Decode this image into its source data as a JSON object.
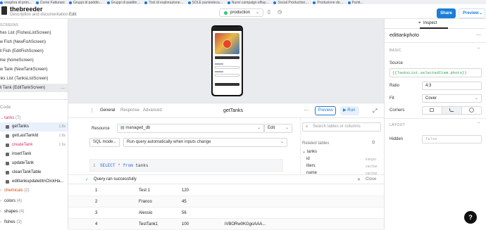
{
  "bookmarks": [
    "onophra di prim...",
    "Come Fatturare",
    "Gruppi di paddin…",
    "Gruppi di paddin…",
    "Tool di esplorazione…",
    "SOLE paninoteca…",
    "Nuovi campaign eBay…",
    "Social Production…",
    "Produzione de…",
    "Partit…"
  ],
  "app": {
    "name": "thebreeder",
    "description": "Description and documentation",
    "edit_label": "Edit"
  },
  "env": {
    "label": "production",
    "status_color": "#2ecc71"
  },
  "toolbar": {
    "share_label": "Share",
    "preview_label": "Preview"
  },
  "screens": {
    "header": "SCREENS",
    "items": [
      "Fishes List (FishesListScreen)",
      "New Fish (NewFishScreen)",
      "Edit Fish (EditFishScreen)",
      "Home (homeScreen)",
      "New Tank (NewTankScreen)",
      "Tanks List (TanksListScreen)",
      "Edit Tank (EditTankScreen)"
    ],
    "selected_index": 6,
    "more": "…"
  },
  "code_tree": {
    "header": "Code",
    "tanks": {
      "label": "tanks",
      "count": "(7)"
    },
    "queries": [
      {
        "label": "getTanks",
        "time": "1.8s",
        "selected": true
      },
      {
        "label": "getLastTankId",
        "time": "1.8s"
      },
      {
        "label": "createTank",
        "time": "1.6s",
        "color": "#d6336c"
      },
      {
        "label": "insertTank",
        "time": ""
      },
      {
        "label": "updateTank",
        "time": ""
      },
      {
        "label": "cleanTankTable",
        "time": ""
      },
      {
        "label": "edittankupdatebtnClickHa...",
        "time": ""
      }
    ],
    "other": [
      {
        "label": "chemicals",
        "count": "(2)",
        "color": "#d9480f"
      },
      {
        "label": "colors",
        "count": "(4)"
      },
      {
        "label": "shapes",
        "count": "(4)"
      },
      {
        "label": "fishes",
        "count": "(3)"
      }
    ]
  },
  "query": {
    "tabs": [
      "General",
      "Response",
      "Advanced"
    ],
    "active_tab": "General",
    "title": "getTanks",
    "preview_label": "Preview",
    "run_label": "Run",
    "resource_label": "Resource",
    "resource_value": "managed_db",
    "resource_mode": "Edit",
    "sql_mode": "SQL mode",
    "run_mode": "Run query automatically when inputs change",
    "code": {
      "line": "1",
      "select": "SELECT",
      "star": "*",
      "from": "from",
      "table": "tanks"
    },
    "schema": {
      "search_placeholder": "Search tables or columns",
      "related": "Related tables",
      "table": "tanks",
      "columns": [
        {
          "name": "id",
          "type": "integer"
        },
        {
          "name": "liters",
          "type": "varchar"
        },
        {
          "name": "name",
          "type": "varchar"
        }
      ]
    },
    "status": {
      "text": "Query ran successfully",
      "close": "Close"
    },
    "results": [
      [
        "1",
        "Test 1",
        "120",
        ""
      ],
      [
        "2",
        "Franco",
        "45",
        ""
      ],
      [
        "3",
        "Alessio",
        "56",
        ""
      ],
      [
        "4",
        "TestTank1",
        "100",
        "iVBORw0KGgoAAA..."
      ]
    ]
  },
  "inspector": {
    "tab": "Inspect",
    "component": "edittankphoto",
    "basic_header": "BASIC",
    "source_label": "Source",
    "source_value": "{{TanksList.selectedItem.photo}}",
    "ratio_label": "Ratio",
    "ratio_value": "4:3",
    "fit_label": "Fit",
    "fit_value": "Cover",
    "corners_label": "Corners",
    "layout_header": "LAYOUT",
    "hidden_label": "Hidden",
    "hidden_value": "false"
  },
  "help": "?"
}
